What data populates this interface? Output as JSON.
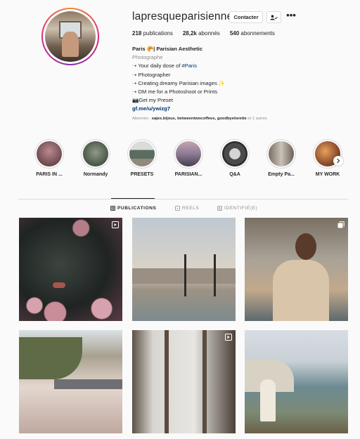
{
  "profile": {
    "username": "lapresqueparisienne",
    "contact_label": "Contacter",
    "more_label": "•••",
    "stats": [
      {
        "value": "218",
        "label": "publications"
      },
      {
        "value": "28,2k",
        "label": "abonnés"
      },
      {
        "value": "540",
        "label": "abonnements"
      }
    ],
    "bio": {
      "name": "Paris 🥐| Parisian Aesthetic",
      "category": "Photographe",
      "line1_pre": "➝ Your daily dose of ",
      "line1_tag": "#Paris",
      "line2": "➝ Photographer",
      "line3": "➝ Creating dreamy Parisian images ✨",
      "line4": "➝ DM me for a Photoshoot or Prints",
      "line5": "📷Get my Preset",
      "link": "gf.me/u/ywizg7"
    },
    "followed_by_prefix": "Abonnés : ",
    "followed_by_names": "sajes.bijoux, betweentwocoffees, goodbyelorette",
    "followed_by_suffix": " et 1 autres"
  },
  "highlights": [
    {
      "label": "PARIS IN ..."
    },
    {
      "label": "Normandy"
    },
    {
      "label": "PRESETS"
    },
    {
      "label": "PARISIAN..."
    },
    {
      "label": "Q&A"
    },
    {
      "label": "Empty Pa..."
    },
    {
      "label": "MY WORK"
    }
  ],
  "tabs": [
    {
      "label": "PUBLICATIONS"
    },
    {
      "label": "REELS"
    },
    {
      "label": "IDENTIFIÉ(E)"
    }
  ],
  "colors": {
    "link": "#00376b",
    "secondary_text": "#8e8e8e",
    "border": "#dbdbdb"
  }
}
